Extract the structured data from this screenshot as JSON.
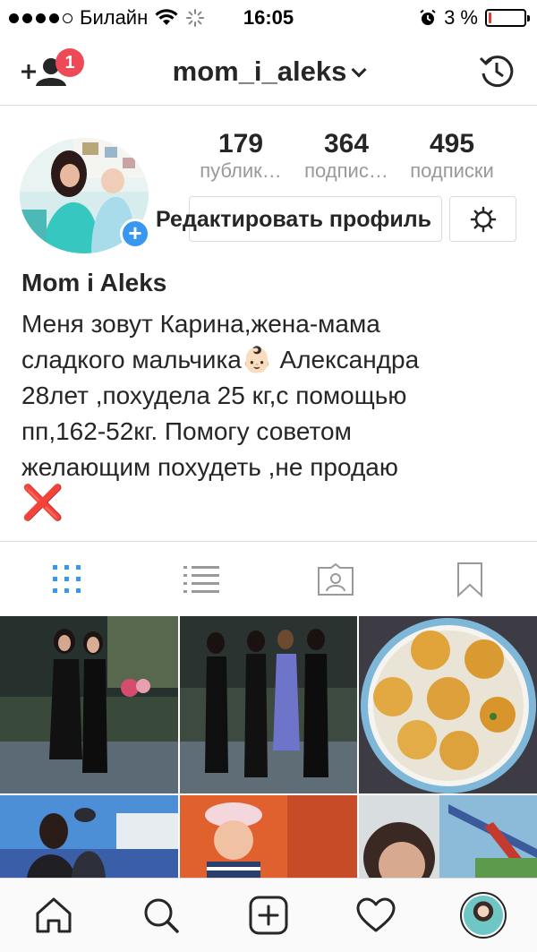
{
  "status_bar": {
    "carrier": "Билайн",
    "time": "16:05",
    "battery_percent": "3 %",
    "battery_level": 0.03,
    "signal_bars_filled": 4
  },
  "nav": {
    "username": "mom_i_aleks",
    "notification_count": "1"
  },
  "stats": [
    {
      "value": "179",
      "label": "публик…"
    },
    {
      "value": "364",
      "label": "подпис…"
    },
    {
      "value": "495",
      "label": "подписки"
    }
  ],
  "edit_profile_label": "Редактировать профиль",
  "profile": {
    "name": "Mom i Aleks",
    "bio_lines": [
      "Меня зовут Карина,жена-мама",
      "сладкого мальчика👶🏻  Александра",
      "28лет ,похудела 25 кг,с помощью",
      "пп,162-52кг. Помогу советом",
      "желающим похудеть ,не продаю"
    ],
    "bio_end_mark": "❌"
  },
  "tabs": [
    {
      "icon": "grid-icon",
      "active": true
    },
    {
      "icon": "list-icon",
      "active": false
    },
    {
      "icon": "tagged-icon",
      "active": false
    },
    {
      "icon": "bookmark-icon",
      "active": false
    }
  ],
  "grid_photos": [
    "photo-two-women-black-dresses",
    "photo-four-women-group",
    "photo-baked-buns-plate",
    "photo-woman-with-child-outdoors",
    "photo-baby-in-hat",
    "photo-woman-selfie-playground"
  ],
  "bottom_nav": [
    "home-icon",
    "search-icon",
    "new-post-icon",
    "activity-heart-icon",
    "profile-avatar"
  ],
  "colors": {
    "accent_blue": "#3897f0",
    "badge_red": "#ed4956",
    "text_dark": "#262626",
    "text_gray": "#999999",
    "border": "#dbdbdb"
  }
}
